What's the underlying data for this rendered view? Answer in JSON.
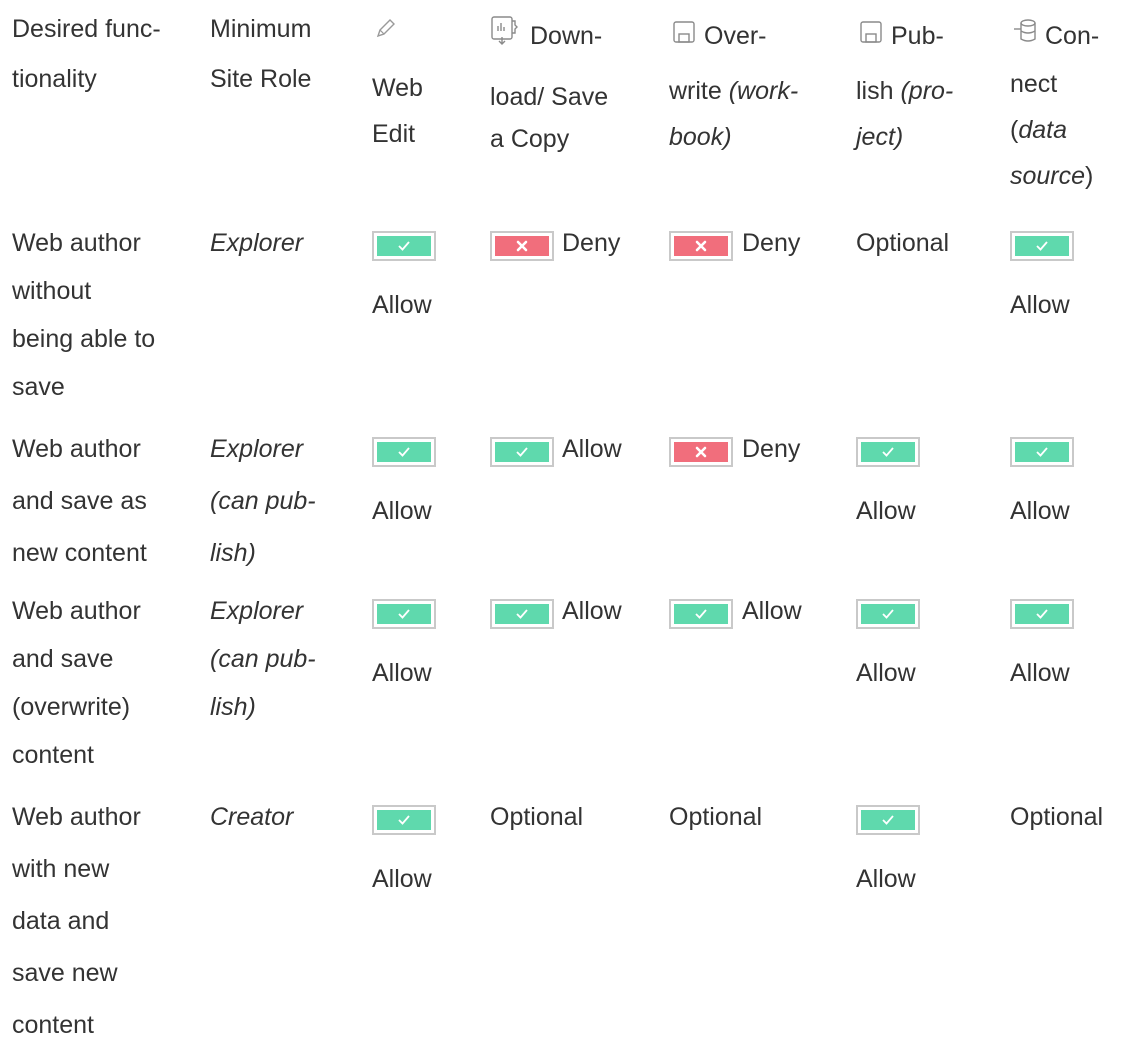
{
  "header": {
    "functionality": [
      "Desired func-",
      "tionality"
    ],
    "site_role": [
      "Minimum",
      "Site Role"
    ],
    "web_edit": {
      "icon": "pencil-icon",
      "lines": [
        "Web",
        "Edit"
      ]
    },
    "download": {
      "icon": "download-icon",
      "first": "Down-",
      "lines": [
        "load/ Save",
        "a Copy"
      ]
    },
    "overwrite": {
      "icon": "save-icon",
      "first": "Over-",
      "line2_a": "write ",
      "line2_b": "(work-",
      "line3": "book)"
    },
    "publish": {
      "icon": "save-icon",
      "first": "Pub-",
      "line2_a": "lish ",
      "line2_b": "(pro-",
      "line3": "ject)"
    },
    "connect": {
      "icon": "database-icon",
      "first": "Con-",
      "line2": "nect",
      "line3_a": "(",
      "line3_b": "data",
      "line4_a": "source",
      "line4_b": ")"
    }
  },
  "status": {
    "allow_icon": "check-icon",
    "deny_icon": "x-icon",
    "allow_color": "#5fd9ad",
    "deny_color": "#f16e7c",
    "allow": "Allow",
    "deny": "Deny",
    "optional": "Optional"
  },
  "rows": [
    {
      "functionality": [
        "Web author",
        "without",
        "being able to",
        "save"
      ],
      "site_role": [
        "Explorer"
      ],
      "web_edit": "Allow",
      "download": "Deny",
      "overwrite": "Deny",
      "publish": "Optional",
      "connect": "Allow"
    },
    {
      "functionality": [
        "Web author",
        "and save as",
        "new content"
      ],
      "site_role": [
        "Explorer",
        "(can pub-",
        "lish)"
      ],
      "web_edit": "Allow",
      "download": "Allow",
      "overwrite": "Deny",
      "publish": "Allow",
      "connect": "Allow"
    },
    {
      "functionality": [
        "Web author",
        "and save",
        "(overwrite)",
        "content"
      ],
      "site_role": [
        "Explorer",
        "(can pub-",
        "lish)"
      ],
      "web_edit": "Allow",
      "download": "Allow",
      "overwrite": "Allow",
      "publish": "Allow",
      "connect": "Allow"
    },
    {
      "functionality": [
        "Web author",
        "with new",
        "data and",
        "save new",
        "content"
      ],
      "site_role": [
        "Creator"
      ],
      "web_edit": "Allow",
      "download": "Optional",
      "overwrite": "Optional",
      "publish": "Allow",
      "connect": "Optional"
    }
  ]
}
